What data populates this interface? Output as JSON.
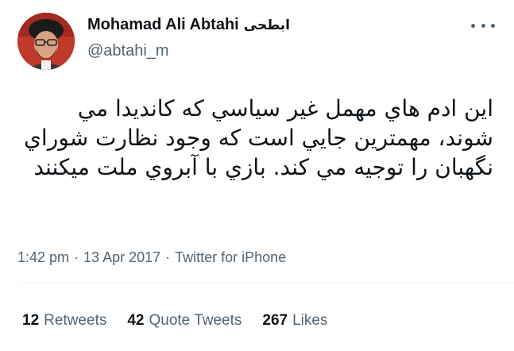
{
  "author": {
    "display_name": "Mohamad Ali Abtahi",
    "display_name_arabic": "ابطحی",
    "handle": "@abtahi_m",
    "avatar_icon": "profile-photo"
  },
  "tweet": {
    "text": "این ادم هاي مهمل غير سياسي كه كانديدا مي شوند، مهمترين جايي است كه وجود نظارت شوراي نگهبان را توجيه مي كند. بازي با آبروي ملت ميكنند"
  },
  "meta": {
    "time": "1:42 pm",
    "separator1": "·",
    "date": "13 Apr 2017",
    "separator2": "·",
    "source": "Twitter for iPhone"
  },
  "stats": {
    "retweets_count": "12",
    "retweets_label": "Retweets",
    "quote_count": "42",
    "quote_label": "Quote Tweets",
    "likes_count": "267",
    "likes_label": "Likes"
  },
  "icons": {
    "more": "more-horizontal-icon"
  },
  "colors": {
    "text_primary": "#0f1419",
    "text_secondary": "#536471",
    "divider": "#eff3f4"
  }
}
